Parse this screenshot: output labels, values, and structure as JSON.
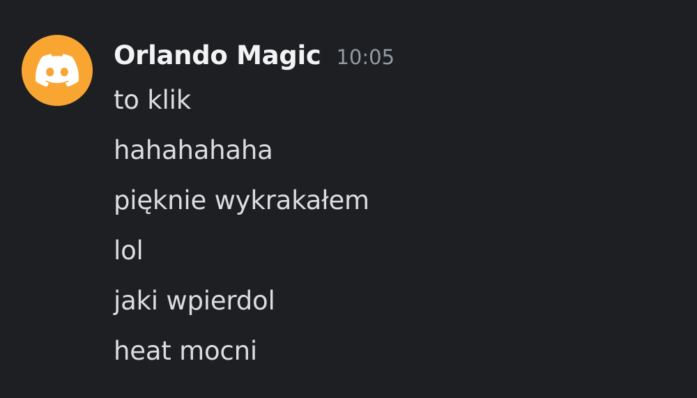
{
  "message_group": {
    "avatar_icon": "discord-logo-icon",
    "avatar_color": "#f8a532",
    "username": "Orlando Magic",
    "timestamp": "10:05",
    "messages": [
      "to klik",
      "hahahahaha",
      "pięknie wykrakałem",
      "lol",
      "jaki wpierdol",
      "heat mocni"
    ]
  }
}
